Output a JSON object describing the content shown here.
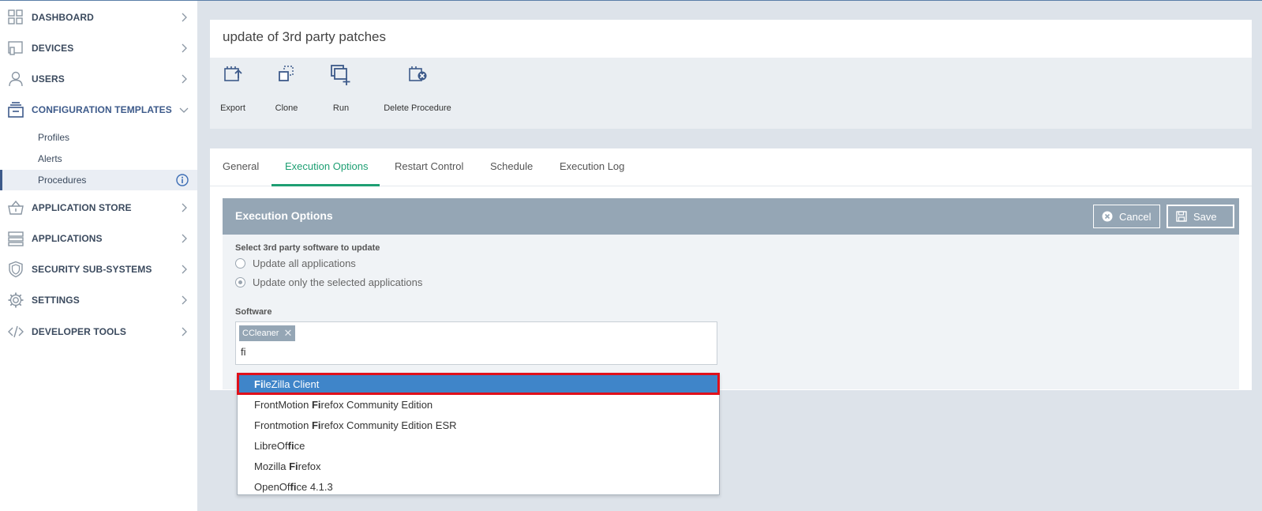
{
  "sidebar": {
    "items": [
      {
        "label": "DASHBOARD",
        "icon": "dashboard-grid-icon"
      },
      {
        "label": "DEVICES",
        "icon": "devices-icon"
      },
      {
        "label": "USERS",
        "icon": "user-icon"
      },
      {
        "label": "CONFIGURATION TEMPLATES",
        "icon": "templates-icon"
      },
      {
        "label": "APPLICATION STORE",
        "icon": "basket-icon"
      },
      {
        "label": "APPLICATIONS",
        "icon": "applications-icon"
      },
      {
        "label": "SECURITY SUB-SYSTEMS",
        "icon": "shield-icon"
      },
      {
        "label": "SETTINGS",
        "icon": "gear-icon"
      },
      {
        "label": "DEVELOPER TOOLS",
        "icon": "code-icon"
      }
    ],
    "subitems": [
      {
        "label": "Profiles"
      },
      {
        "label": "Alerts"
      },
      {
        "label": "Procedures"
      }
    ]
  },
  "header": {
    "title": "update of 3rd party patches",
    "tools": [
      {
        "label": "Export",
        "icon": "export-icon"
      },
      {
        "label": "Clone",
        "icon": "clone-icon"
      },
      {
        "label": "Run",
        "icon": "run-icon"
      },
      {
        "label": "Delete Procedure",
        "icon": "delete-procedure-icon"
      }
    ]
  },
  "tabs": [
    {
      "label": "General"
    },
    {
      "label": "Execution Options"
    },
    {
      "label": "Restart Control"
    },
    {
      "label": "Schedule"
    },
    {
      "label": "Execution Log"
    }
  ],
  "panel": {
    "title": "Execution Options",
    "cancel_label": "Cancel",
    "save_label": "Save",
    "select_label": "Select 3rd party software to update",
    "radio_all": "Update all applications",
    "radio_selected": "Update only the selected applications",
    "software_label": "Software",
    "chip": "CCleaner",
    "typed": "fi"
  },
  "dropdown": {
    "options": [
      {
        "pre": "",
        "match": "Fi",
        "post": "leZilla Client"
      },
      {
        "pre": "FrontMotion ",
        "match": "Fi",
        "post": "refox Community Edition"
      },
      {
        "pre": "Frontmotion ",
        "match": "Fi",
        "post": "refox Community Edition ESR"
      },
      {
        "pre": "LibreOf",
        "match": "fi",
        "post": "ce"
      },
      {
        "pre": "Mozilla ",
        "match": "Fi",
        "post": "refox"
      },
      {
        "pre": "OpenOf",
        "match": "fi",
        "post": "ce 4.1.3"
      }
    ]
  },
  "colors": {
    "accent_green": "#1e9f73",
    "panel_header": "#95a6b5",
    "highlight_blue": "#3f85c9",
    "highlight_outline": "#e0101a"
  }
}
